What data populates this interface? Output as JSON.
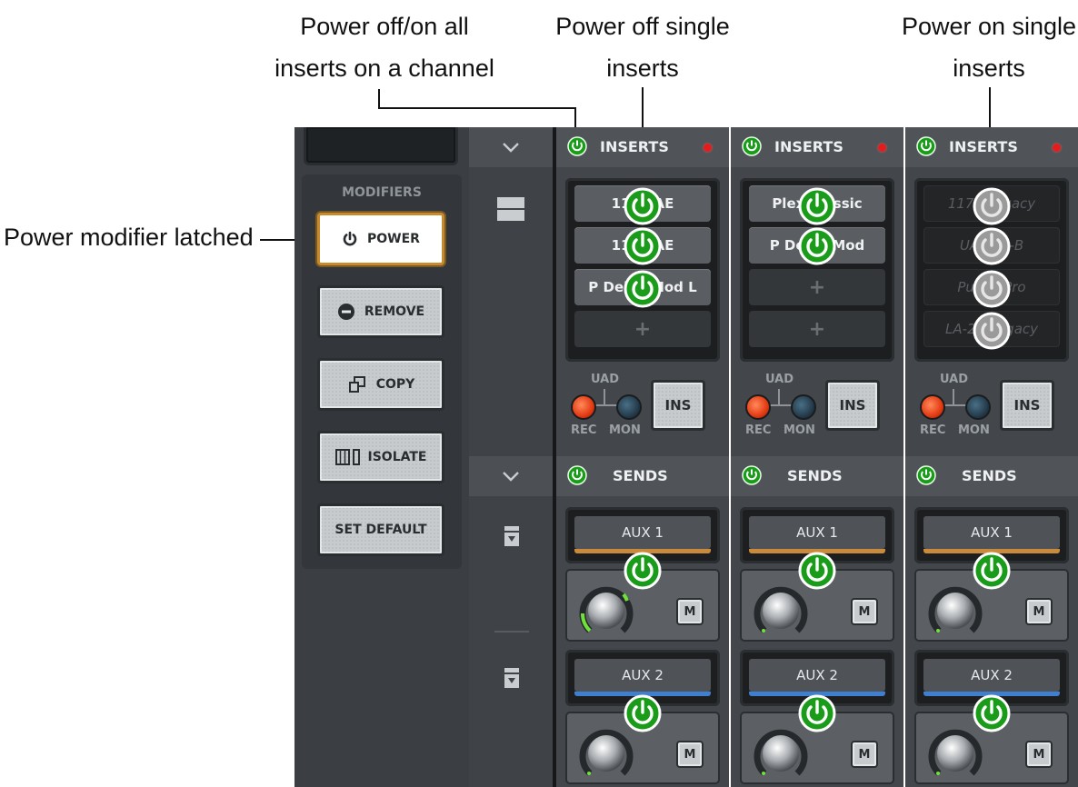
{
  "annotations": {
    "all_inserts": [
      "Power  off/on all",
      "inserts on a channel"
    ],
    "single_off": [
      "Power  off single",
      "inserts"
    ],
    "single_on": [
      "Power on single",
      "inserts"
    ],
    "latched": "Power modifier latched"
  },
  "modifiers": {
    "title": "MODIFIERS",
    "power": "POWER",
    "remove": "REMOVE",
    "copy": "COPY",
    "isolate": "ISOLATE",
    "set_default": "SET DEFAULT"
  },
  "channels": [
    {
      "inserts_label": "INSERTS",
      "slots": [
        "1176 AE",
        "1176 AE",
        "P Delay Mod L",
        "+"
      ],
      "uad": "UAD",
      "rec": "REC",
      "mon": "MON",
      "ins": "INS",
      "sends_label": "SENDS",
      "aux1": "AUX 1",
      "aux2": "AUX 2",
      "mute": "M"
    },
    {
      "inserts_label": "INSERTS",
      "slots": [
        "Plex Classic",
        "P Delay Mod",
        "+",
        "+"
      ],
      "uad": "UAD",
      "rec": "REC",
      "mon": "MON",
      "ins": "INS",
      "sends_label": "SENDS",
      "aux1": "AUX 1",
      "aux2": "AUX 2",
      "mute": "M"
    },
    {
      "inserts_label": "INSERTS",
      "slots": [
        "1176 Legacy",
        "UA 610-B",
        "Pultec Pro",
        "LA-2A Legacy"
      ],
      "uad": "UAD",
      "rec": "REC",
      "mon": "MON",
      "ins": "INS",
      "sends_label": "SENDS",
      "aux1": "AUX 1",
      "aux2": "AUX 2",
      "mute": "M"
    }
  ],
  "colors": {
    "power_on": "#1a9c1a",
    "power_off": "#9a9a9a",
    "aux1_bar": "#c98a3c",
    "aux2_bar": "#3f7fcf",
    "latched_border": "#c88a2e"
  },
  "icons": [
    "chevron-down-icon",
    "power-icon",
    "minus-circle-icon",
    "copy-icon",
    "isolate-icon",
    "layout-icon",
    "send-down-icon"
  ]
}
